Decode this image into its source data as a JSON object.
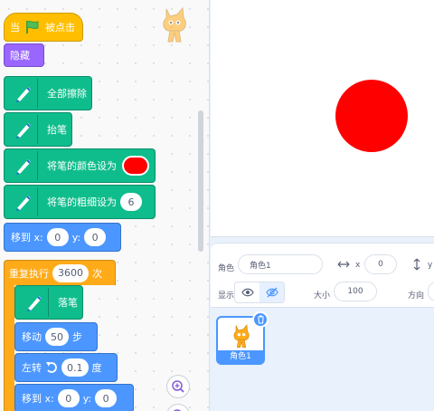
{
  "code_area": {
    "hat_block": {
      "when_label": "当",
      "clicked_label": "被点击"
    },
    "hide_block": {
      "label": "隐藏"
    },
    "clear_block": {
      "label": "全部擦除"
    },
    "pen_up_block": {
      "label": "抬笔"
    },
    "set_color_block": {
      "label": "将笔的颜色设为",
      "color": "#ff0000"
    },
    "set_size_block": {
      "label": "将笔的粗细设为",
      "value": "6"
    },
    "goto_block_1": {
      "label": "移到 x:",
      "x": "0",
      "y_label": "y:",
      "y": "0"
    },
    "repeat_block": {
      "label": "重复执行",
      "count": "3600",
      "suffix": "次"
    },
    "pen_down_block": {
      "label": "落笔"
    },
    "move_block": {
      "label": "移动",
      "steps": "50",
      "suffix": "步"
    },
    "turn_block": {
      "label": "左转",
      "degrees": "0.1",
      "suffix": "度"
    },
    "goto_block_2": {
      "label": "移到 x:",
      "x": "0",
      "y_label": "y:",
      "y": "0"
    }
  },
  "stage": {
    "circle_color": "#ff0000"
  },
  "sprite_info": {
    "sprite_label": "角色",
    "sprite_name": "角色1",
    "x_label": "x",
    "x_value": "0",
    "y_label": "y",
    "show_label": "显示",
    "size_label": "大小",
    "size_value": "100",
    "direction_label": "方向"
  },
  "sprite_list": {
    "sprites": [
      {
        "name": "角色1"
      }
    ]
  },
  "colors": {
    "events": "#ffbf00",
    "looks": "#9966ff",
    "pen": "#0fbd8c",
    "motion": "#4c97ff",
    "control": "#ffab19"
  }
}
